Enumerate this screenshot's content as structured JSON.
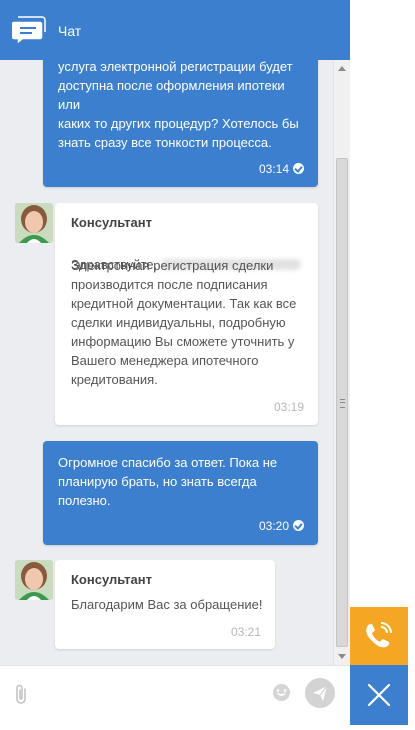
{
  "header": {
    "title": "Чат"
  },
  "messages": [
    {
      "text": "услуга электронной регистрации будет\nдоступна после оформления ипотеки\nили\nкаких  то других процедур? Хотелось бы\nзнать сразу все тонкости процесса.",
      "time": "03:14"
    },
    {
      "sender": "Консультант",
      "greeting": "Здравствуйте,",
      "text": "Электронная регистрация сделки\nпроизводится после подписания\nкредитной документации. Так как все\nсделки индивидуальны, подробную\nинформацию Вы сможете уточнить у\nВашего менеджера ипотечного\nкредитования.",
      "time": "03:19"
    },
    {
      "text": "Огромное спасибо за ответ. Пока не\nпланирую брать, но знать всегда\nполезно.",
      "time": "03:20"
    },
    {
      "sender": "Консультант",
      "text": "Благодарим Вас за обращение!",
      "time": "03:21"
    }
  ],
  "icons": {
    "chat": "chat-bubble-icon",
    "attach": "paperclip-icon",
    "emoji": "smiley-icon",
    "send": "paper-plane-icon",
    "call": "phone-icon",
    "close": "close-icon",
    "read": "check-circle-icon"
  },
  "colors": {
    "brand_blue": "#3d7fcf",
    "call_orange": "#f5a623",
    "chat_background": "#ebedf0"
  }
}
